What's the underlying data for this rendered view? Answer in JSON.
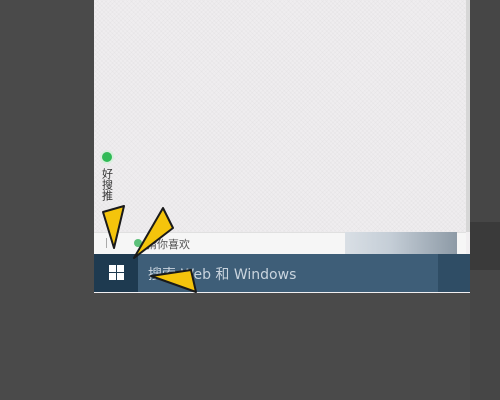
{
  "widget": {
    "label": "好搜推"
  },
  "news_bar": {
    "text": "猜你喜欢"
  },
  "taskbar": {
    "start_icon": "windows-logo-icon",
    "search_placeholder": "搜索 Web 和 Windows"
  },
  "colors": {
    "taskbar": "#3a5a74",
    "start_button": "#1e3a50",
    "arrow_fill": "#f4c40c",
    "green_dot": "#2fbb55"
  }
}
